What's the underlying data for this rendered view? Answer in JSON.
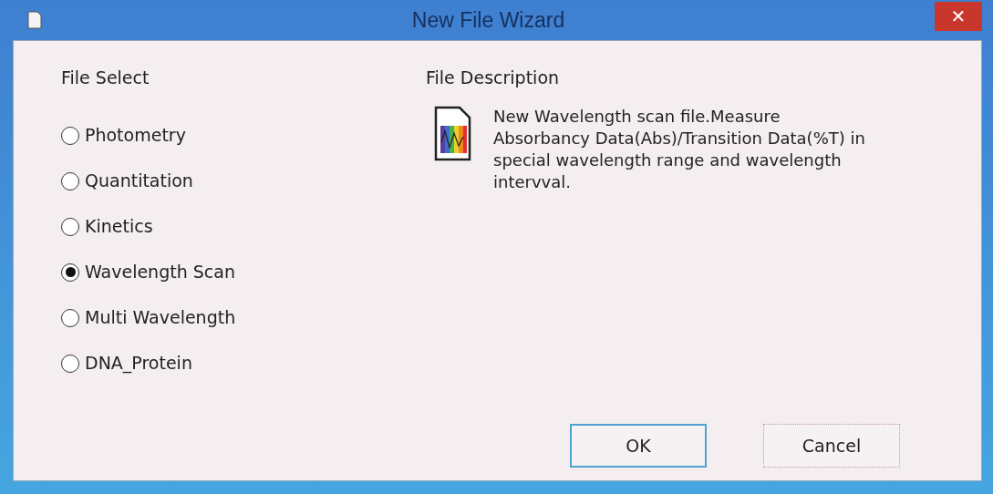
{
  "window": {
    "title": "New File Wizard",
    "close_glyph": "✕"
  },
  "file_select": {
    "heading": "File Select",
    "options": [
      {
        "label": "Photometry",
        "selected": false
      },
      {
        "label": "Quantitation",
        "selected": false
      },
      {
        "label": "Kinetics",
        "selected": false
      },
      {
        "label": "Wavelength Scan",
        "selected": true
      },
      {
        "label": "Multi Wavelength",
        "selected": false
      },
      {
        "label": "DNA_Protein",
        "selected": false
      }
    ]
  },
  "file_description": {
    "heading": "File Description",
    "text": "New Wavelength scan file.Measure Absorbancy Data(Abs)/Transition Data(%T) in special wavelength range and wavelength intervval."
  },
  "buttons": [
    {
      "label": "OK",
      "default": true
    },
    {
      "label": "Cancel",
      "default": false
    }
  ]
}
